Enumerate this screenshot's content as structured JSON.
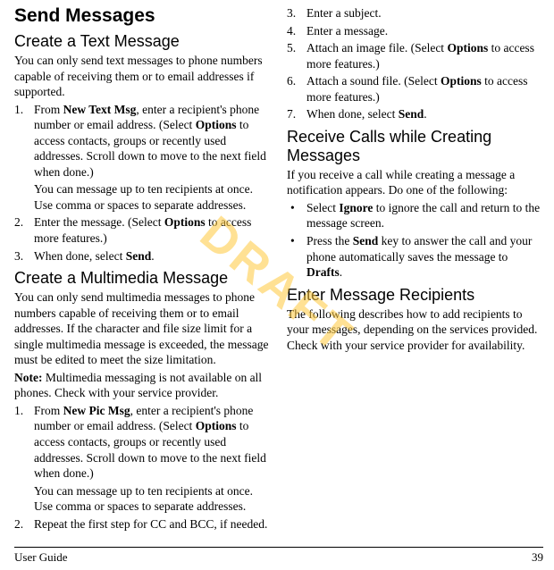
{
  "watermark": "DRAFT",
  "title": "Send Messages",
  "sections": {
    "createText": {
      "heading": "Create a Text Message",
      "intro": "You can only send text messages to phone numbers capable of receiving them or to email addresses if supported.",
      "step1a": "From ",
      "step1b": "New Text Msg",
      "step1c": ", enter a recipient's phone number or email address. (Select ",
      "step1d": "Options",
      "step1e": " to access contacts, groups or recently used addresses. Scroll down to move to the next field when done.)",
      "step1sub": "You can message up to ten recipients at once. Use comma or spaces to separate addresses.",
      "step2a": "Enter the message. (Select ",
      "step2b": "Options",
      "step2c": " to access more features.)",
      "step3a": "When done, select ",
      "step3b": "Send",
      "step3c": "."
    },
    "createMulti": {
      "heading": "Create a Multimedia Message",
      "intro": "You can only send multimedia messages to phone numbers capable of receiving them or to email addresses. If the character and file size limit for a single multimedia message is exceeded, the message must be edited to meet the size limitation.",
      "notea": "Note:",
      "noteb": " Multimedia messaging is not available on all phones. Check with your service provider.",
      "step1a": "From ",
      "step1b": "New Pic Msg",
      "step1c": ", enter a recipient's phone number or email address. (Select ",
      "step1d": "Options",
      "step1e": " to access contacts, groups or recently used addresses. Scroll down to move to the next field when done.)",
      "step1sub": "You can message up to ten recipients at once. Use comma or spaces to separate addresses.",
      "step2": "Repeat the first step for CC and BCC, if needed.",
      "step3": "Enter a subject.",
      "step4": "Enter a message.",
      "step5a": "Attach an image file. (Select ",
      "step5b": "Options",
      "step5c": " to access more features.)",
      "step6a": "Attach a sound file. (Select ",
      "step6b": "Options",
      "step6c": " to access more features.)",
      "step7a": "When done, select ",
      "step7b": "Send",
      "step7c": "."
    },
    "receiveCalls": {
      "heading": "Receive Calls while Creating Messages",
      "intro": "If you receive a call while creating a message a notification appears. Do one of the following:",
      "b1a": "Select ",
      "b1b": "Ignore",
      "b1c": " to ignore the call and return to the message screen.",
      "b2a": "Press the ",
      "b2b": "Send",
      "b2c": " key to answer the call and your phone automatically saves the message to ",
      "b2d": "Drafts",
      "b2e": "."
    },
    "enterRecipients": {
      "heading": "Enter Message Recipients",
      "intro": "The following describes how to add recipients to your messages, depending on the services provided. Check with your service provider for availability."
    }
  },
  "footer": {
    "left": "User Guide",
    "right": "39"
  }
}
